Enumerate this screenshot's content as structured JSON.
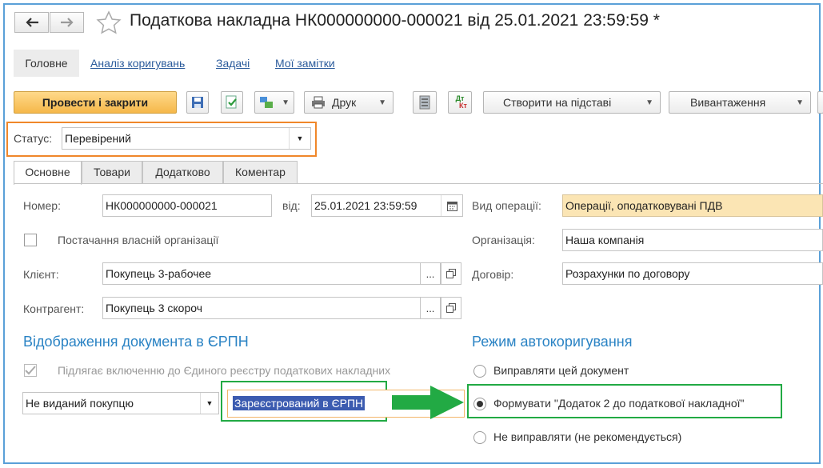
{
  "window": {
    "title": "Податкова накладна НК000000000-000021 від 25.01.2021 23:59:59 *"
  },
  "nav_tabs": [
    "Головне",
    "Аналіз коригувань",
    "Задачі",
    "Мої замітки"
  ],
  "toolbar": {
    "post_close": "Провести і закрити",
    "print": "Друк",
    "create_based": "Створити на підставі",
    "export": "Вивантаження",
    "dt_kt_top": "Дт",
    "dt_kt_bottom": "Кт"
  },
  "status": {
    "label": "Статус:",
    "value": "Перевірений"
  },
  "form_tabs": [
    "Основне",
    "Товари",
    "Додатково",
    "Коментар"
  ],
  "form": {
    "number_label": "Номер:",
    "number_value": "НК000000000-000021",
    "date_label": "від:",
    "date_value": "25.01.2021 23:59:59",
    "own_supply_label": "Постачання власній організації",
    "client_label": "Клієнт:",
    "client_value": "Покупець 3-рабочее",
    "counterparty_label": "Контрагент:",
    "counterparty_value": "Покупець 3 скороч",
    "op_type_label": "Вид операції:",
    "op_type_value": "Операції, оподатковувані ПДВ",
    "org_label": "Організація:",
    "org_value": "Наша компанія",
    "contract_label": "Договір:",
    "contract_value": "Розрахунки по договору",
    "dots": "..."
  },
  "erpn": {
    "heading": "Відображення документа в ЄРПН",
    "include_label": "Підлягає включенню до Єдиного реєстру податкових накладних",
    "issued_value": "Не виданий покупцю",
    "registered_value": "Зареєстрований в ЄРПН"
  },
  "autocorrect": {
    "heading": "Режим автокоригування",
    "options": [
      "Виправляти цей документ",
      "Формувати \"Додаток 2 до податкової накладної\"",
      "Не виправляти (не рекомендується)"
    ],
    "selected_index": 1
  },
  "colors": {
    "accent_orange": "#f0872a",
    "highlight_green": "#22aa44",
    "section_blue": "#2a83c4",
    "frame_blue": "#5aa0d8"
  }
}
